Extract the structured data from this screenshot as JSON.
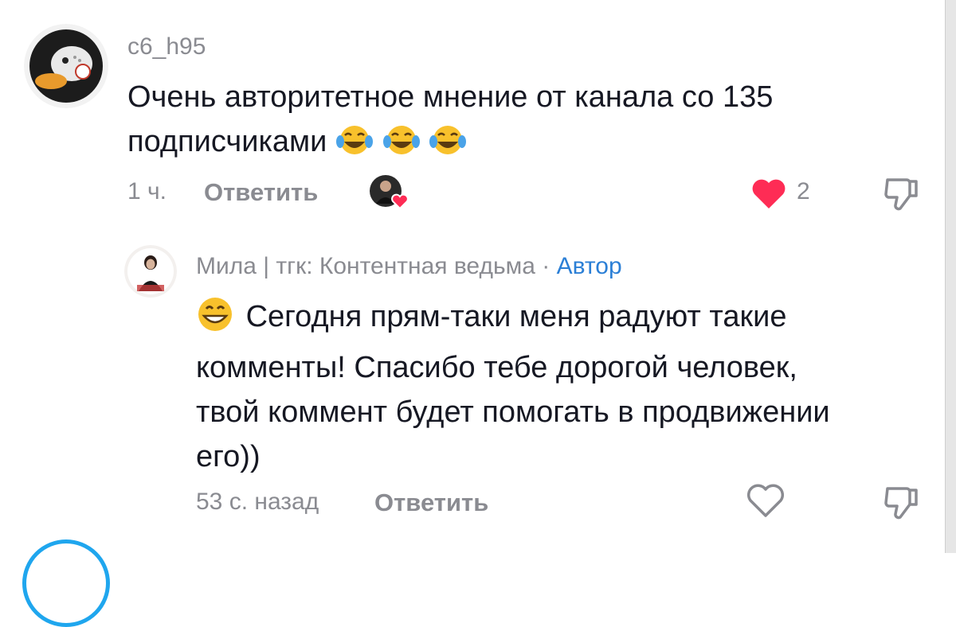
{
  "comments": [
    {
      "username": "c6_h95",
      "text_line1": "Очень авторитетное мнение от канала со 135",
      "text_line2": "подписчиками",
      "emoji": "tears-of-joy-emoji",
      "emoji_count": 3,
      "time": "1 ч.",
      "reply_label": "Ответить",
      "like_count": "2",
      "liked": true,
      "author_liked": true
    },
    {
      "username": "Мила | тгк: Контентная ведьма",
      "separator": " · ",
      "author_label": "Автор",
      "emoji": "grinning-face-emoji",
      "text_lines": [
        "Сегодня прям-таки меня радуют такие",
        "комменты! Спасибо тебе дорогой человек,",
        "твой коммент будет помогать в продвижении",
        "его))"
      ],
      "time": "53 с. назад",
      "reply_label": "Ответить",
      "liked": false
    }
  ],
  "colors": {
    "like_red": "#fe2c55",
    "muted": "#8a8b91",
    "author_blue": "#2b7fd6",
    "text": "#161823"
  }
}
